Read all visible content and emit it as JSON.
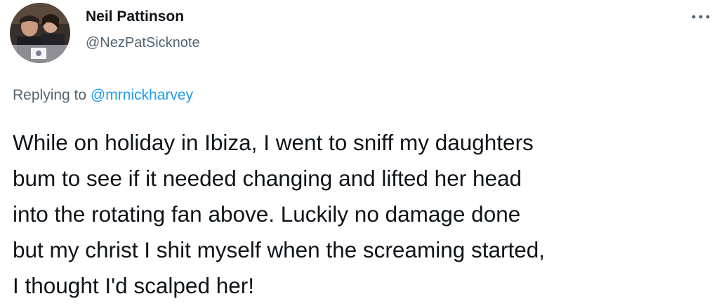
{
  "tweet": {
    "author": {
      "display_name": "Neil Pattinson",
      "handle": "@NezPatSicknote",
      "avatar_icon": "profile-photo"
    },
    "menu_icon": "more-options-icon",
    "reply_context": {
      "prefix": "Replying to",
      "mention": "@mrnickharvey"
    },
    "text_lines": [
      "While on holiday in Ibiza, I went to sniff my daughters",
      "bum to see if it needed changing and lifted her head",
      "into the rotating fan above. Luckily no damage done",
      "but my christ I shit myself when the screaming started,",
      "I thought I'd scalped her!"
    ]
  },
  "colors": {
    "text_primary": "#0f1419",
    "text_secondary": "#536471",
    "link": "#1d9bf0",
    "background": "#ffffff"
  }
}
